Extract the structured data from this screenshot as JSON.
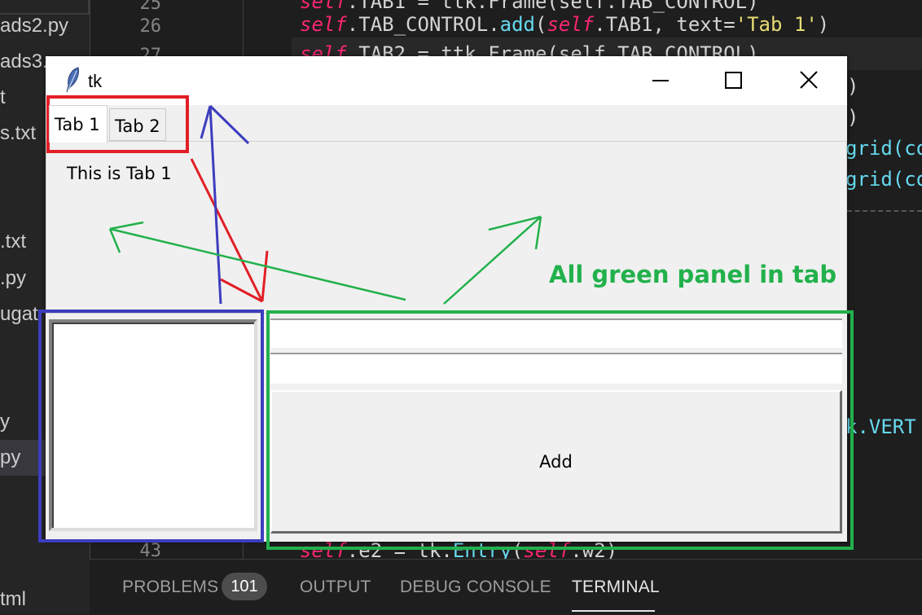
{
  "explorer": {
    "items": [
      "ads2.py",
      "ads3.",
      "t",
      "s.txt",
      "",
      "",
      ".txt",
      ".py",
      "ugat",
      "",
      "",
      "y",
      "py",
      "",
      "",
      "",
      "tml"
    ]
  },
  "editor": {
    "line_numbers": [
      "25",
      "26",
      "27",
      "43"
    ],
    "lines": {
      "l25": {
        "kw": "self",
        "rest": ".TAB1 = ttk.Frame(self.TAB_CONTROL)"
      },
      "l26": {
        "kw1": "self",
        "p1": ".TAB_CONTROL.",
        "fn": "add",
        "p2": "(",
        "kw2": "self",
        "p3": ".TAB1, text=",
        "str": "'Tab 1'",
        "p4": ")"
      },
      "l27": {
        "kw": "self",
        "rest": ".TAB2 = ttk.Frame(self.TAB_CONTROL)"
      },
      "l_grid1": "grid(co",
      "l_grid2": "grid(co",
      "l_vert": "k.VERT",
      "l_paren1": ")",
      "l_paren2": ")",
      "l43": {
        "kw1": "self",
        "p1": ".e2 = tk.",
        "fn": "Entry",
        "p2": "(",
        "kw2": "self",
        "p3": ".w2)"
      }
    }
  },
  "panel": {
    "tabs": {
      "problems": "PROBLEMS",
      "output": "OUTPUT",
      "debug": "DEBUG CONSOLE",
      "terminal": "TERMINAL"
    },
    "problems_count": "101"
  },
  "tk": {
    "title": "tk",
    "tabs": [
      "Tab 1",
      "Tab 2"
    ],
    "tab_content": "This is Tab 1",
    "add_button": "Add",
    "entry1_value": "",
    "entry2_value": ""
  },
  "annotation": {
    "text": "All green panel in tab",
    "colors": {
      "red": "#e21f26",
      "blue": "#3d3dbf",
      "green": "#22b14c"
    }
  },
  "colors": {
    "tk_bg": "#f0f0f0",
    "vscode_bg": "#1e1e1e",
    "explorer_bg": "#252526"
  }
}
